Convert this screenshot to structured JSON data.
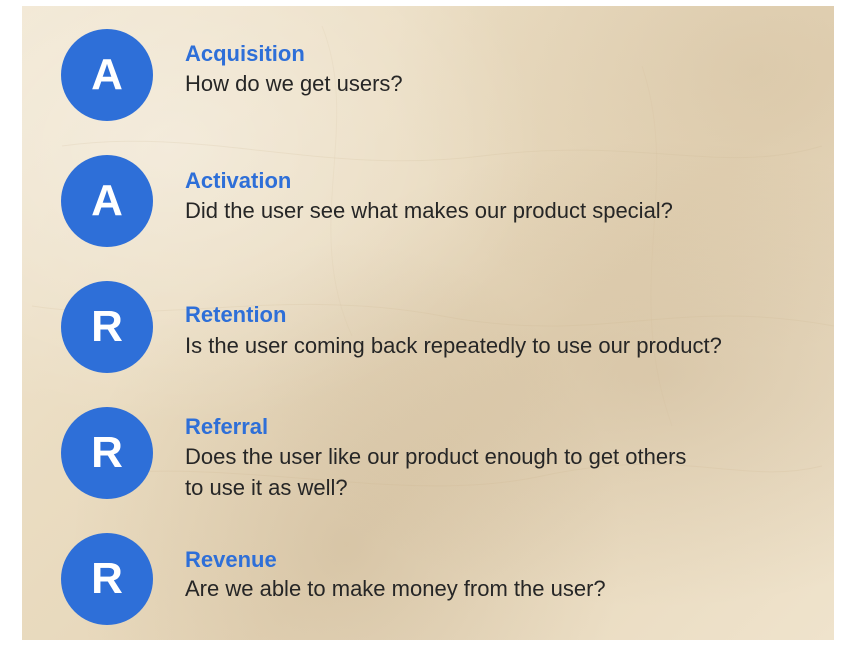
{
  "colors": {
    "accent": "#2e6fd8",
    "text": "#262626",
    "background": "#ecdfc6"
  },
  "items": [
    {
      "letter": "A",
      "title": "Acquisition",
      "lines": [
        "How do we get users?"
      ]
    },
    {
      "letter": "A",
      "title": "Activation",
      "lines": [
        "Did the user see what makes our product special?"
      ]
    },
    {
      "letter": "R",
      "title": "Retention",
      "lines": [
        "Is the user coming back repeatedly to use our product?"
      ]
    },
    {
      "letter": "R",
      "title": "Referral",
      "lines": [
        "Does the user like our product enough to get others",
        "to use it as well?"
      ]
    },
    {
      "letter": "R",
      "title": "Revenue",
      "lines": [
        "Are we able to make money from the user?"
      ]
    }
  ]
}
